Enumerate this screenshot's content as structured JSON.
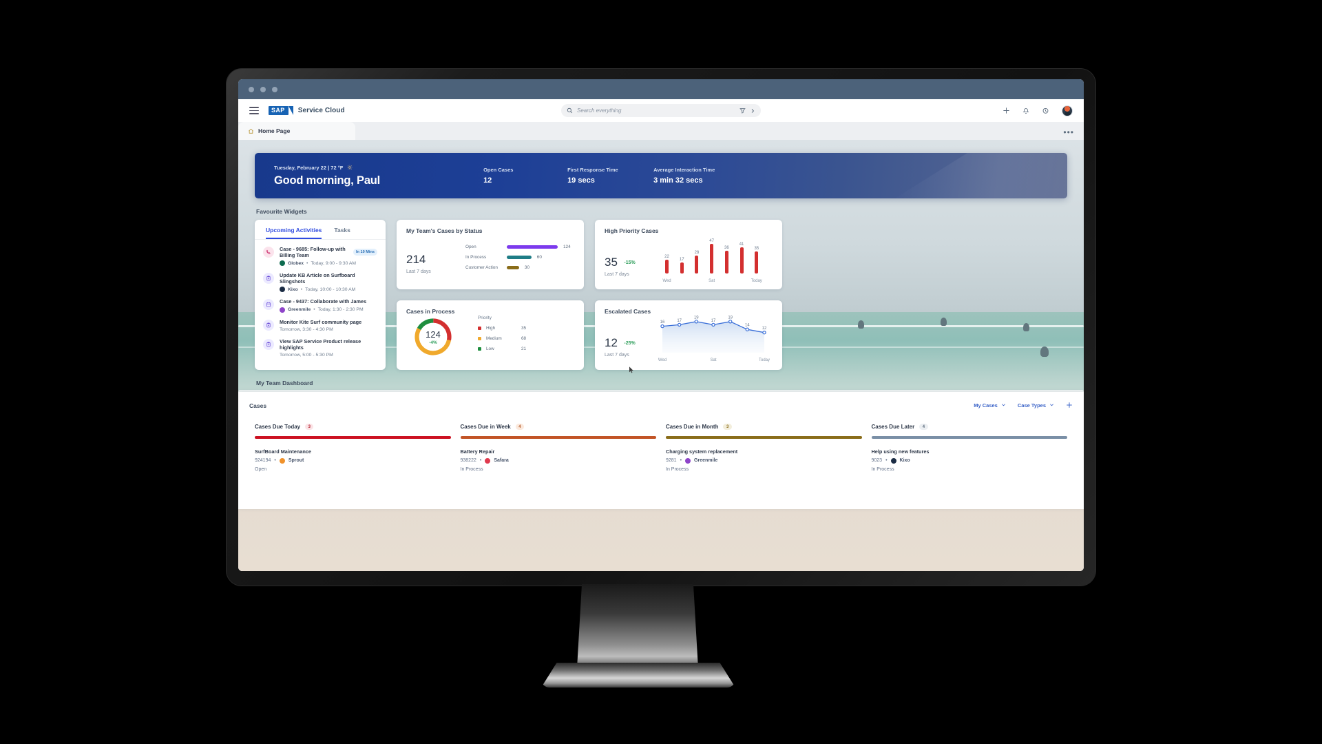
{
  "browser": {
    "dots": 3
  },
  "topbar": {
    "menu_icon": "hamburger-icon",
    "logo_text": "SAP",
    "brand": "Service Cloud",
    "search": {
      "placeholder": "Search everything",
      "value": "",
      "filter_icon": "filter-icon",
      "expand_icon": "chevron-right-icon"
    },
    "actions": [
      "plus-icon",
      "bell-icon",
      "history-icon",
      "avatar"
    ]
  },
  "tabstrip": {
    "tab_label": "Home Page",
    "tab_icon": "home-icon",
    "more_icon": "overflow-menu-icon"
  },
  "hero": {
    "date": "Tuesday, February 22 | 72 °F",
    "weather_icon": "sun-icon",
    "greeting": "Good morning, Paul",
    "kpis": [
      {
        "label": "Open Cases",
        "value": "12"
      },
      {
        "label": "First Response Time",
        "value": "19 secs"
      },
      {
        "label": "Average Interaction Time",
        "value": "3 min 32 secs"
      }
    ]
  },
  "favourite_widgets": {
    "title": "Favourite Widgets"
  },
  "activities": {
    "tabs": [
      {
        "label": "Upcoming Activities",
        "active": true
      },
      {
        "label": "Tasks",
        "active": false
      }
    ],
    "items": [
      {
        "icon": "phone-icon",
        "icon_kind": "ic-phone",
        "title": "Case - 9685: Follow-up with Billing Team",
        "badge": "In 10 Mins",
        "account": "Globex",
        "account_color": "#0d6b4f",
        "meta": "Today, 9:00 - 9:30 AM"
      },
      {
        "icon": "task-icon",
        "icon_kind": "ic-task",
        "title": "Update KB Article on Surfboard Slingshots",
        "badge": "",
        "account": "Kixo",
        "account_color": "#1b2c44",
        "meta": "Today, 10:00 - 10:30 AM"
      },
      {
        "icon": "calendar-icon",
        "icon_kind": "ic-cal",
        "title": "Case - 9437: Collaborate with James",
        "badge": "",
        "account": "Greenmile",
        "account_color": "#8e44c9",
        "meta": "Today, 1:30 - 2:30 PM"
      },
      {
        "icon": "task-icon",
        "icon_kind": "ic-task",
        "title": "Monitor Kite Surf community page",
        "badge": "",
        "account": "",
        "account_color": "",
        "meta": "Tomorrow, 3:30 - 4:30 PM"
      },
      {
        "icon": "task-icon",
        "icon_kind": "ic-task",
        "title": "View SAP Service Product release highlights",
        "badge": "",
        "account": "",
        "account_color": "",
        "meta": "Tomorrow, 5:00 - 5:30 PM"
      }
    ]
  },
  "widget_status": {
    "title": "My Team's Cases by Status",
    "total": "214",
    "period": "Last 7 days",
    "chart_data": {
      "type": "bar",
      "title": "My Team's Cases by Status",
      "orientation": "horizontal",
      "categories": [
        "Open",
        "In Process",
        "Customer Action"
      ],
      "values": [
        124,
        60,
        30
      ],
      "colors": [
        "#7c3aed",
        "#1f7d86",
        "#8a6d1a"
      ],
      "max": 124
    }
  },
  "widget_high_priority": {
    "title": "High Priority Cases",
    "total": "35",
    "delta": "-15%",
    "period": "Last 7 days",
    "chart_data": {
      "type": "bar",
      "title": "High Priority Cases",
      "categories": [
        "Wed",
        "Thu",
        "Fri",
        "Sat",
        "Sun",
        "Mon",
        "Today"
      ],
      "tick_labels": [
        "Wed",
        "",
        "",
        "Sat",
        "",
        "",
        "Today"
      ],
      "values": [
        22,
        17,
        28,
        47,
        36,
        41,
        35
      ],
      "color": "#d32f2f",
      "ylim": [
        0,
        50
      ]
    }
  },
  "widget_in_process": {
    "title": "Cases in Process",
    "total": "124",
    "delta": "-4%",
    "legend_title": "Priority",
    "chart_data": {
      "type": "pie",
      "title": "Cases in Process",
      "labels": [
        "High",
        "Medium",
        "Low"
      ],
      "values": [
        35,
        68,
        21
      ],
      "colors": [
        "#d32f2f",
        "#f0a92c",
        "#1e8e3e"
      ],
      "total": 124
    }
  },
  "widget_escalated": {
    "title": "Escalated Cases",
    "total": "12",
    "delta": "-25%",
    "period": "Last 7 days",
    "chart_data": {
      "type": "line",
      "title": "Escalated Cases",
      "categories": [
        "Wed",
        "Thu",
        "Fri",
        "Sat",
        "Sun",
        "Mon",
        "Today"
      ],
      "tick_labels": [
        "Wed",
        "",
        "",
        "Sat",
        "",
        "",
        "Today"
      ],
      "values": [
        16,
        17,
        19,
        17,
        19,
        14,
        12
      ],
      "color": "#3a6fd8",
      "ylim": [
        0,
        22
      ]
    }
  },
  "team_dashboard": {
    "title": "My Team Dashboard"
  },
  "cases": {
    "title": "Cases",
    "filter_view": "My Cases",
    "filter_type": "Case Types",
    "add_icon": "plus-icon",
    "chevron_icon": "chevron-down-icon",
    "columns": [
      {
        "name": "Cases Due Today",
        "count": "3",
        "bar_color": "#cc1122",
        "count_bg": "#fbe3e6",
        "count_fg": "#b3202e",
        "item": {
          "title": "SurfBoard Maintenance",
          "id": "924194",
          "account": "Sprout",
          "account_color": "#f0922b",
          "status": "Open"
        }
      },
      {
        "name": "Cases Due in Week",
        "count": "4",
        "bar_color": "#c25426",
        "count_bg": "#fbe9dd",
        "count_fg": "#b45a27",
        "item": {
          "title": "Battery Repair",
          "id": "938222",
          "account": "Safara",
          "account_color": "#e03a4e",
          "status": "In Process"
        }
      },
      {
        "name": "Cases Due in Month",
        "count": "3",
        "bar_color": "#8a6d1a",
        "count_bg": "#f3eedc",
        "count_fg": "#8a6d1a",
        "item": {
          "title": "Charging system replacement",
          "id": "9281",
          "account": "Greenmile",
          "account_color": "#8e44c9",
          "status": "In Process"
        }
      },
      {
        "name": "Cases Due Later",
        "count": "4",
        "bar_color": "#7a8fa6",
        "count_bg": "#eceff2",
        "count_fg": "#5b6b7d",
        "item": {
          "title": "Help using new features",
          "id": "9023",
          "account": "Kixo",
          "account_color": "#1b2c44",
          "status": "In Process"
        }
      }
    ]
  }
}
